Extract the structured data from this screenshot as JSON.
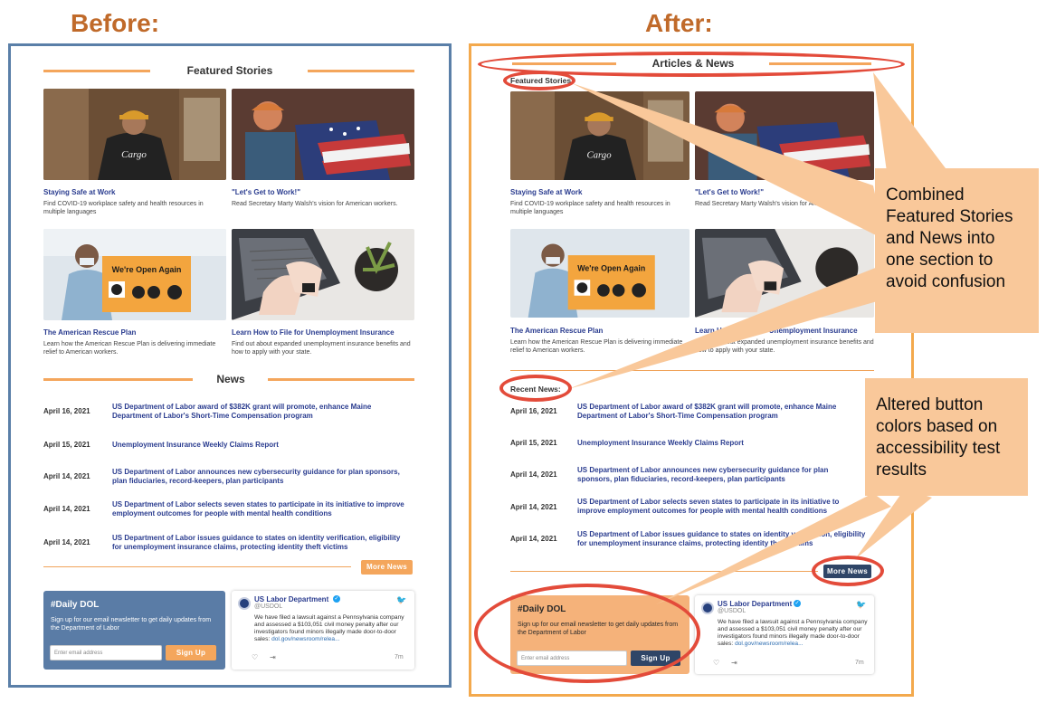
{
  "labels": {
    "before": "Before:",
    "after": "After:"
  },
  "before": {
    "featured_title": "Featured Stories",
    "news_title": "News",
    "more_news": "More News",
    "signup": {
      "title": "#Daily DOL",
      "desc": "Sign up for our email newsletter to get daily updates from the Department of Labor",
      "placeholder": "Enter email address",
      "button": "Sign Up"
    }
  },
  "after": {
    "section_title": "Articles & News",
    "featured_label": "Featured Stories",
    "recent_label": "Recent News:",
    "more_news": "More News",
    "signup": {
      "title": "#Daily DOL",
      "desc": "Sign up for our email newsletter to get daily updates from the Department of Labor",
      "placeholder": "Enter email address",
      "button": "Sign Up"
    }
  },
  "stories": [
    {
      "title": "Staying Safe at Work",
      "desc": "Find COVID-19 workplace safety and health resources in multiple languages"
    },
    {
      "title": "\"Let's Get to Work!\"",
      "desc": "Read Secretary Marty Walsh's vision for American workers."
    },
    {
      "title": "The American Rescue Plan",
      "desc": "Learn how the American Rescue Plan is delivering immediate relief to American workers."
    },
    {
      "title": "Learn How to File for Unemployment Insurance",
      "desc": "Find out about expanded unemployment insurance benefits and how to apply with your state."
    }
  ],
  "photo_text": {
    "cargo": "Cargo",
    "open": "We're Open Again"
  },
  "news": [
    {
      "date": "April 16, 2021",
      "title": "US Department of Labor award of $382K grant will promote, enhance Maine Department of Labor's Short-Time Compensation program"
    },
    {
      "date": "April 15, 2021",
      "title": "Unemployment Insurance Weekly Claims Report"
    },
    {
      "date": "April 14, 2021",
      "title": "US Department of Labor announces new cybersecurity guidance for plan sponsors, plan fiduciaries, record-keepers, plan participants"
    },
    {
      "date": "April 14, 2021",
      "title": "US Department of Labor selects seven states to participate in its initiative to improve employment outcomes for people with mental health conditions"
    },
    {
      "date": "April 14, 2021",
      "title": "US Department of Labor issues guidance to states on identity verification, eligibility for unemployment insurance claims, protecting identity theft victims"
    }
  ],
  "tweet": {
    "name": "US Labor Department",
    "handle": "@USDOL",
    "body": "We have filed a lawsuit against a Pennsylvania company and assessed a $103,051 civil money penalty after our investigators found minors illegally made door-to-door sales:",
    "link": "dol.gov/newsroom/relea...",
    "time": "7m"
  },
  "callouts": {
    "combined": "Combined Featured Stories and News into one section to avoid confusion",
    "altered": "Altered button colors based on accessibility test results"
  },
  "colors": {
    "accent_orange": "#f4a65c",
    "navy": "#2f4567",
    "before_signup_bg": "#5a7ca6",
    "after_signup_bg": "#f5b27a",
    "ring_red": "#e34b3a",
    "callout_bg": "#f9c89a"
  }
}
